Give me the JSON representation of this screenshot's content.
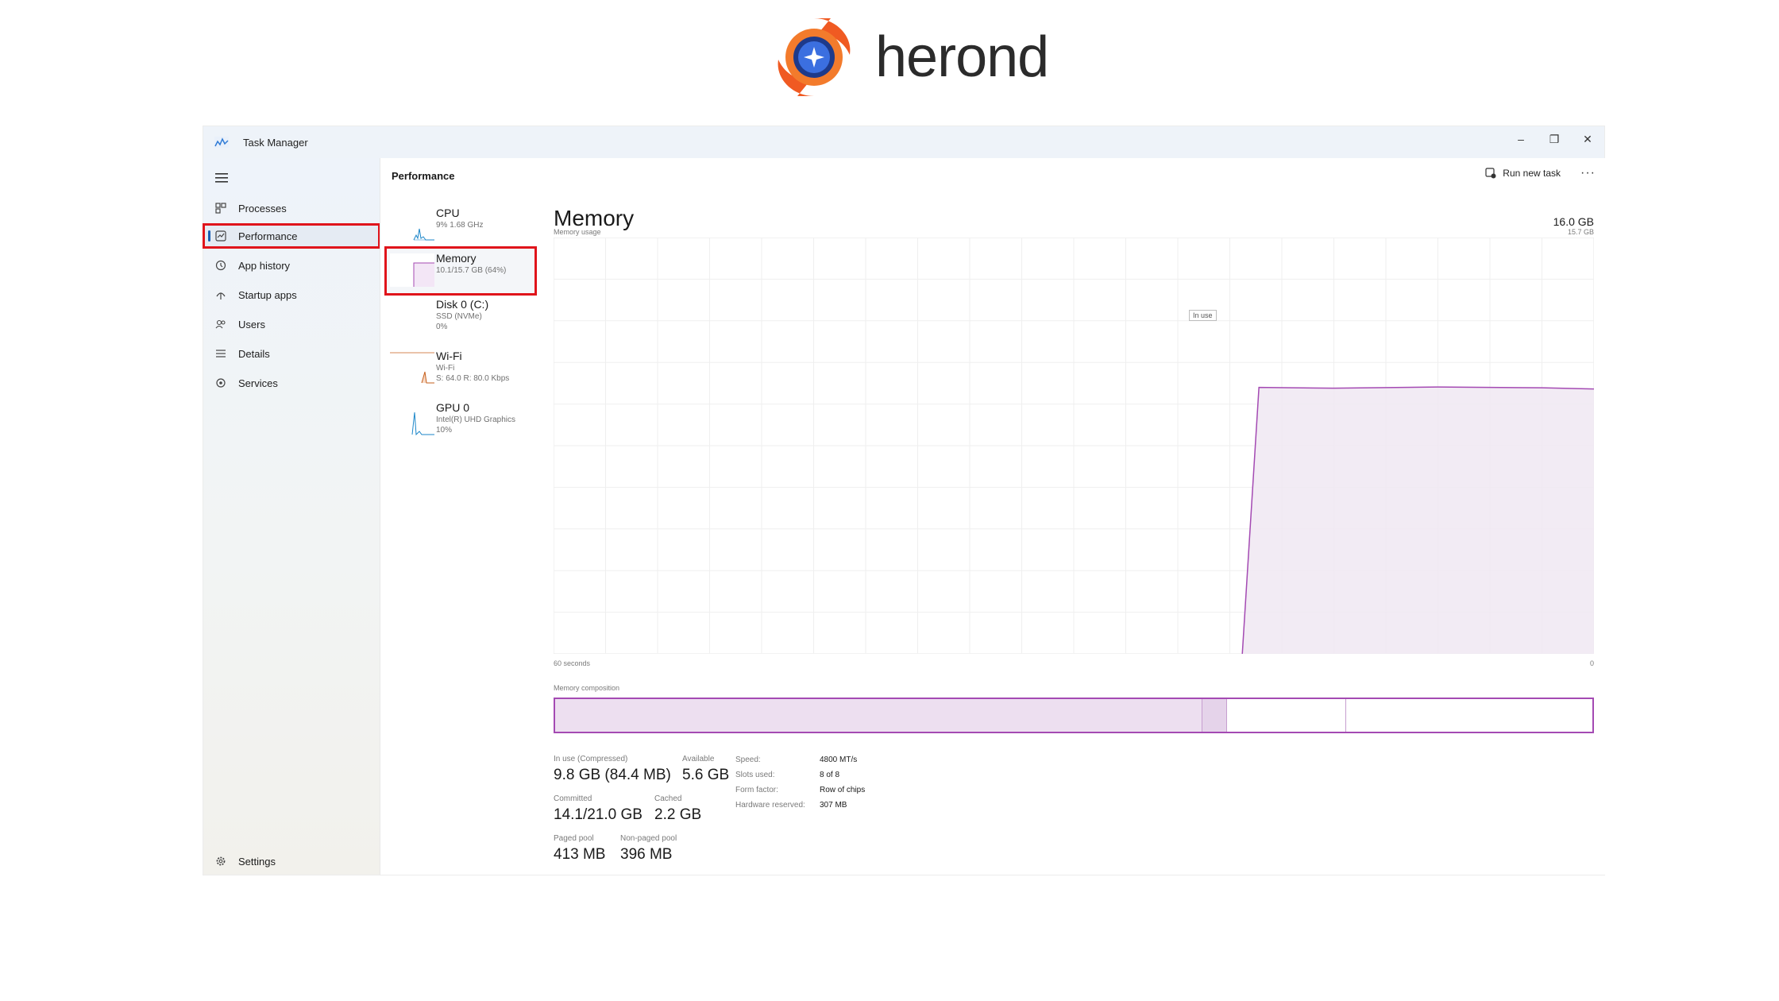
{
  "brand": {
    "name": "herond"
  },
  "window": {
    "title": "Task Manager",
    "controls": {
      "minimize": "–",
      "restore": "❐",
      "close": "✕"
    }
  },
  "sidebar": {
    "items": [
      {
        "label": "Processes",
        "icon": "processes-icon"
      },
      {
        "label": "Performance",
        "icon": "performance-icon",
        "selected": true
      },
      {
        "label": "App history",
        "icon": "history-icon"
      },
      {
        "label": "Startup apps",
        "icon": "startup-icon"
      },
      {
        "label": "Users",
        "icon": "users-icon"
      },
      {
        "label": "Details",
        "icon": "details-icon"
      },
      {
        "label": "Services",
        "icon": "services-icon"
      }
    ],
    "settings_label": "Settings"
  },
  "header": {
    "title": "Performance",
    "run_new_task": "Run new task",
    "more": "···"
  },
  "devices": [
    {
      "name": "CPU",
      "sub1": "9%  1.68 GHz",
      "sub2": "",
      "color": "#1b86c9"
    },
    {
      "name": "Memory",
      "sub1": "10.1/15.7 GB (64%)",
      "sub2": "",
      "color": "#a44ab3",
      "selected": true
    },
    {
      "name": "Disk 0 (C:)",
      "sub1": "SSD (NVMe)",
      "sub2": "0%",
      "color": "#4aa02c"
    },
    {
      "name": "Wi-Fi",
      "sub1": "Wi-Fi",
      "sub2": "S: 64.0  R: 80.0 Kbps",
      "color": "#c65f1c"
    },
    {
      "name": "GPU 0",
      "sub1": "Intel(R) UHD Graphics",
      "sub2": "10%",
      "color": "#1b86c9"
    }
  ],
  "memory": {
    "title": "Memory",
    "total": "16.0 GB",
    "usage_label": "Memory usage",
    "usage_max": "15.7 GB",
    "tooltip": "In use",
    "time_left": "60 seconds",
    "time_right": "0",
    "composition_label": "Memory composition",
    "composition": {
      "in_use": 0.624,
      "modified": 0.024,
      "standby": 0.115,
      "free": 0.237
    },
    "graph_level": 0.64,
    "stats": {
      "in_use_label": "In use (Compressed)",
      "in_use_value": "9.8 GB (84.4 MB)",
      "available_label": "Available",
      "available_value": "5.6 GB",
      "committed_label": "Committed",
      "committed_value": "14.1/21.0 GB",
      "cached_label": "Cached",
      "cached_value": "2.2 GB",
      "paged_label": "Paged pool",
      "paged_value": "413 MB",
      "nonpaged_label": "Non-paged pool",
      "nonpaged_value": "396 MB"
    },
    "specs": {
      "speed_label": "Speed:",
      "speed_value": "4800 MT/s",
      "slots_label": "Slots used:",
      "slots_value": "8 of 8",
      "form_label": "Form factor:",
      "form_value": "Row of chips",
      "reserved_label": "Hardware reserved:",
      "reserved_value": "307 MB"
    },
    "accent": "#a44ab3"
  }
}
